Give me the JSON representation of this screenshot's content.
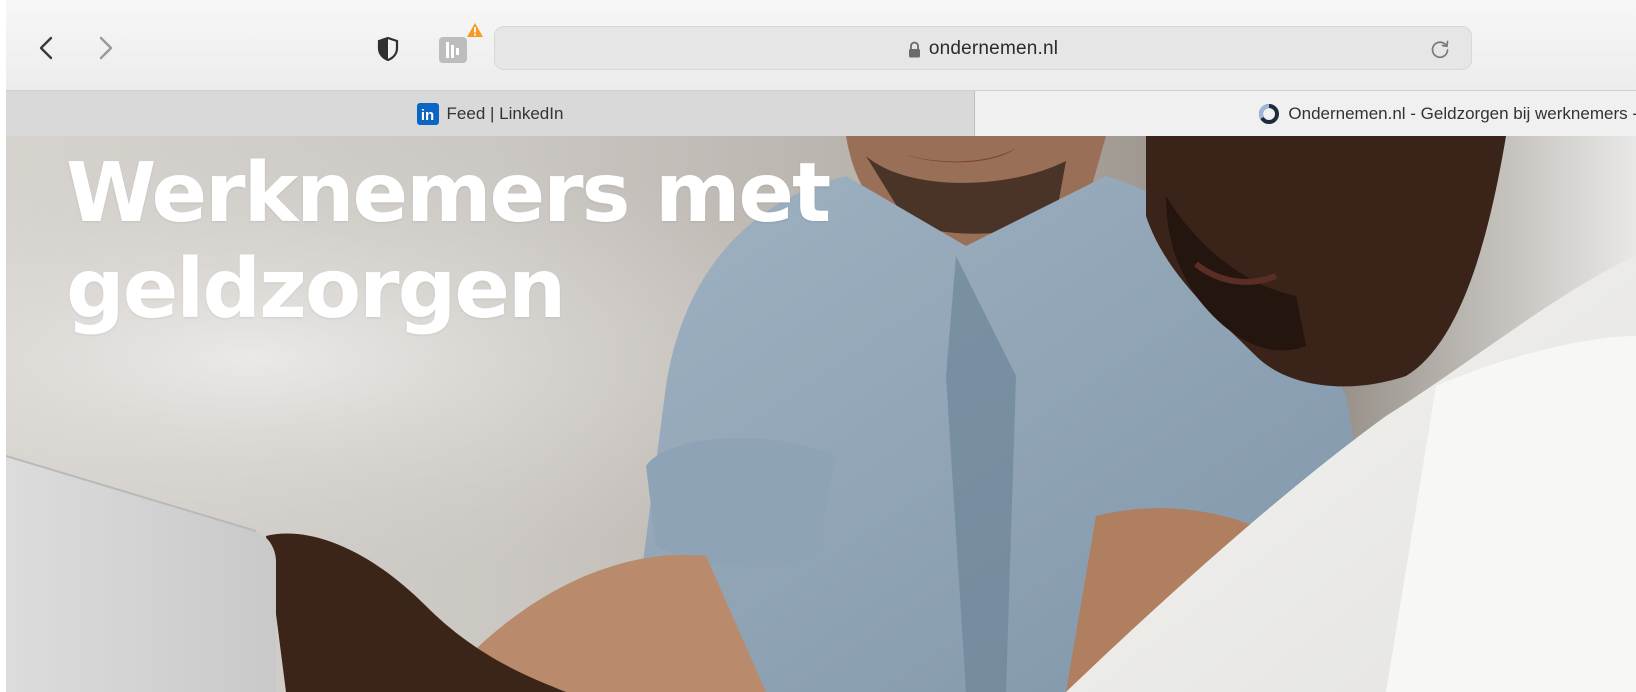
{
  "browser": {
    "url": "ondernemen.nl",
    "icons": {
      "back": "chevron-left-icon",
      "forward": "chevron-right-icon",
      "privacy": "shield-icon",
      "extension": "extension-icon",
      "lock": "lock-icon",
      "reload": "reload-icon"
    },
    "tabs": [
      {
        "title": "Feed | LinkedIn",
        "favicon": "linkedin-icon",
        "active": false
      },
      {
        "title": "Ondernemen.nl - Geldzorgen bij werknemers -",
        "favicon": "ondernemen-icon",
        "active": true
      }
    ],
    "colors": {
      "warning": "#f59a23",
      "linkedin": "#0a66c2"
    }
  },
  "page": {
    "hero": {
      "title_line1": "Werknemers met",
      "title_line2": "geldzorgen"
    }
  }
}
